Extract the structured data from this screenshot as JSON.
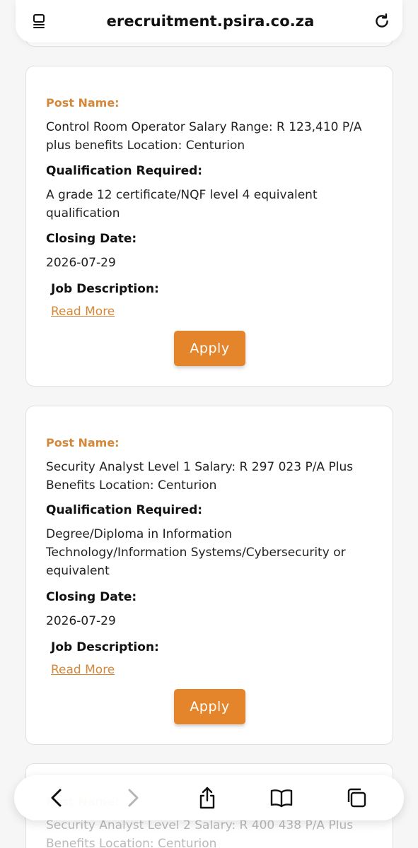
{
  "browser": {
    "url": "erecruitment.psira.co.za"
  },
  "labels": {
    "post_name": "Post Name:",
    "qualification": "Qualification Required:",
    "closing_date": "Closing Date:",
    "job_description": "Job Description:",
    "read_more": "Read More",
    "apply": "Apply"
  },
  "jobs": [
    {
      "post": "Control Room Operator Salary Range: R 123,410 P/A plus benefits Location: Centurion",
      "qualification": "A grade 12 certificate/NQF level 4 equivalent qualification",
      "closing_date": "2026-07-29"
    },
    {
      "post": "Security Analyst Level 1 Salary: R 297 023 P/A Plus Benefits Location: Centurion",
      "qualification": "Degree/Diploma in Information Technology/Information Systems/Cybersecurity or equivalent",
      "closing_date": "2026-07-29"
    },
    {
      "post": "Security Analyst Level 2 Salary: R 400 438 P/A Plus Benefits Location: Centurion"
    }
  ],
  "colors": {
    "accent": "#e4852c",
    "label_orange": "#d5883a"
  },
  "icons": {
    "tabs_overview": "sidebar-icon",
    "reload": "reload-icon",
    "back": "chevron-left-icon",
    "forward": "chevron-right-icon",
    "share": "share-icon",
    "bookmarks": "book-icon",
    "tabs": "tabs-icon"
  }
}
